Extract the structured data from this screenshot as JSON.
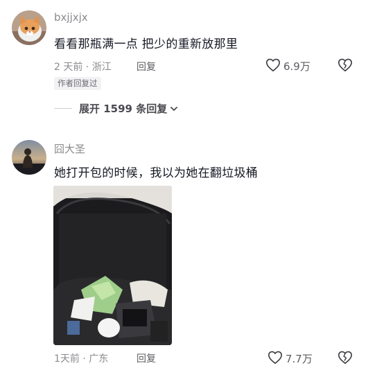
{
  "comments": [
    {
      "username": "bxjjxjx",
      "content": "看看那瓶满一点 把少的重新放那里",
      "time_location": "2 天前 · 浙江",
      "reply_label": "回复",
      "likes": "6.9万",
      "author_badge": "作者回复过",
      "expand_label": "展开 1599 条回复"
    },
    {
      "username": "囧大圣",
      "content": "她打开包的时候，我以为她在翻垃圾桶",
      "time_location": "1天前 · 广东",
      "reply_label": "回复",
      "likes": "7.7万"
    }
  ],
  "icons": {
    "like": "heart-outline-icon",
    "dislike": "broken-heart-icon",
    "expand": "chevron-down-icon"
  },
  "colors": {
    "text_primary": "#161823",
    "text_secondary": "#8a8a8e",
    "background": "#ffffff"
  }
}
